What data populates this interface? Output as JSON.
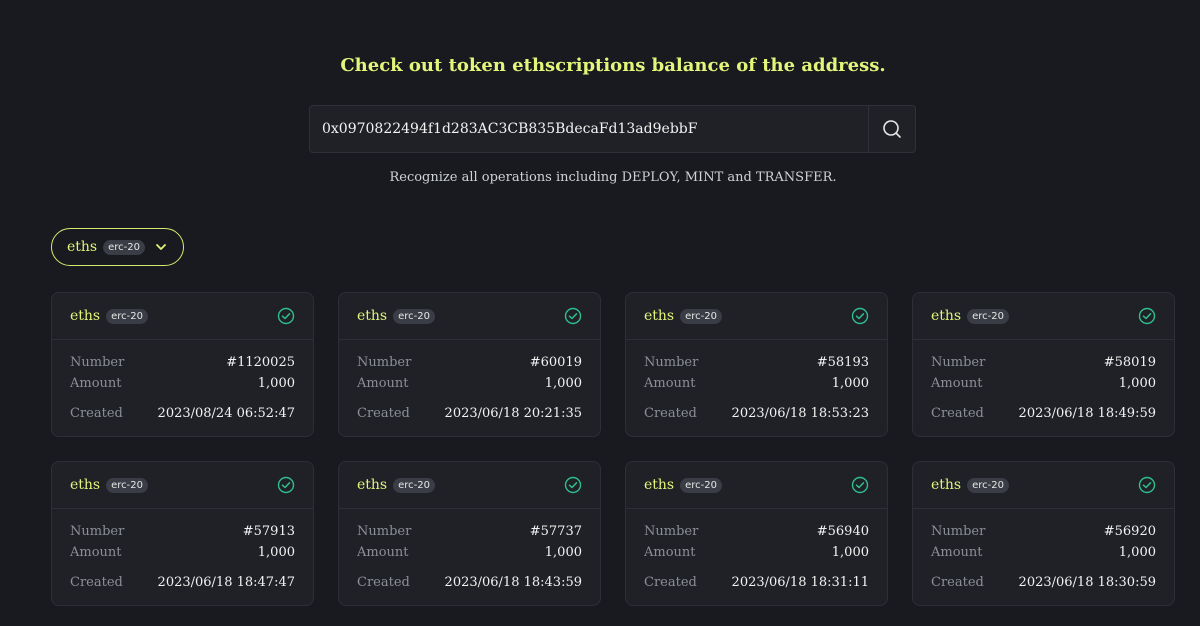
{
  "header": {
    "headline": "Check out token ethscriptions balance of the address.",
    "subtitle": "Recognize all operations including DEPLOY, MINT and TRANSFER."
  },
  "search": {
    "value": "0x0970822494f1d283AC3CB835BdecaFd13ad9ebbF",
    "icon": "search-icon"
  },
  "filter": {
    "tick": "eths",
    "badge": "erc-20",
    "icon": "chevron-down-icon"
  },
  "labels": {
    "number": "Number",
    "amount": "Amount",
    "created": "Created"
  },
  "colors": {
    "accent": "#e3f57a",
    "check": "#2fbf8a",
    "background": "#181a1f",
    "card": "#1f2127"
  },
  "cards": [
    {
      "tick": "eths",
      "badge": "erc-20",
      "number": "#1120025",
      "amount": "1,000",
      "created": "2023/08/24 06:52:47"
    },
    {
      "tick": "eths",
      "badge": "erc-20",
      "number": "#60019",
      "amount": "1,000",
      "created": "2023/06/18 20:21:35"
    },
    {
      "tick": "eths",
      "badge": "erc-20",
      "number": "#58193",
      "amount": "1,000",
      "created": "2023/06/18 18:53:23"
    },
    {
      "tick": "eths",
      "badge": "erc-20",
      "number": "#58019",
      "amount": "1,000",
      "created": "2023/06/18 18:49:59"
    },
    {
      "tick": "eths",
      "badge": "erc-20",
      "number": "#57913",
      "amount": "1,000",
      "created": "2023/06/18 18:47:47"
    },
    {
      "tick": "eths",
      "badge": "erc-20",
      "number": "#57737",
      "amount": "1,000",
      "created": "2023/06/18 18:43:59"
    },
    {
      "tick": "eths",
      "badge": "erc-20",
      "number": "#56940",
      "amount": "1,000",
      "created": "2023/06/18 18:31:11"
    },
    {
      "tick": "eths",
      "badge": "erc-20",
      "number": "#56920",
      "amount": "1,000",
      "created": "2023/06/18 18:30:59"
    }
  ]
}
